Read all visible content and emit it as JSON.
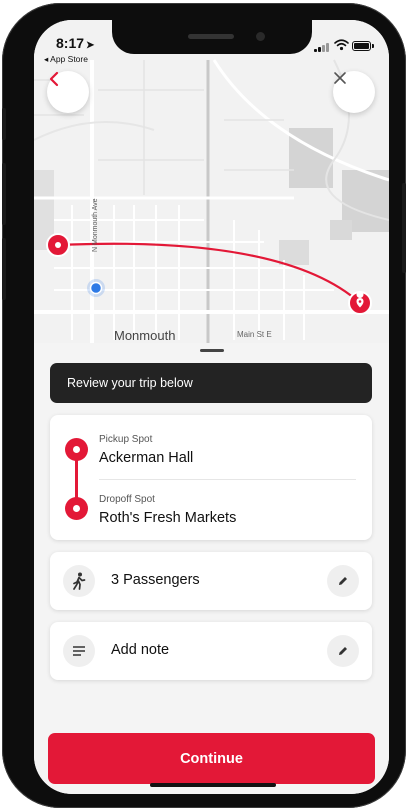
{
  "status_bar": {
    "time": "8:17",
    "back_app": "◂ App Store"
  },
  "map": {
    "town_label": "Monmouth",
    "street_label": "Main St E",
    "avenue_label": "N Monmouth Ave"
  },
  "review_banner": "Review your trip below",
  "trip": {
    "pickup_label": "Pickup Spot",
    "pickup_value": "Ackerman Hall",
    "dropoff_label": "Dropoff Spot",
    "dropoff_value": "Roth's Fresh Markets"
  },
  "passengers": {
    "text": "3 Passengers",
    "icon": "walking-person-icon"
  },
  "note": {
    "text": "Add note",
    "icon": "note-lines-icon"
  },
  "continue_label": "Continue",
  "colors": {
    "accent": "#e31837",
    "banner": "#232323",
    "location_dot": "#2e7ae6"
  }
}
